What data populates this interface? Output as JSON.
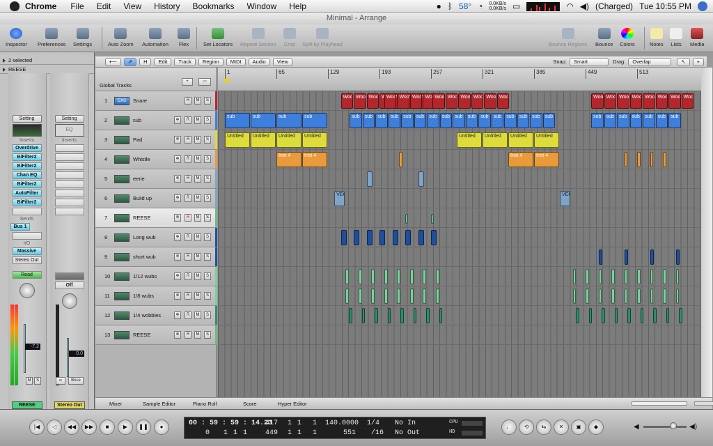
{
  "menubar": {
    "app": "Chrome",
    "items": [
      "File",
      "Edit",
      "View",
      "History",
      "Bookmarks",
      "Window",
      "Help"
    ],
    "temp": "58°",
    "net_up": "0.0KB/s",
    "net_down": "0.0KB/s",
    "battery": "(Charged)",
    "clock": "Tue 10:55 PM"
  },
  "window": {
    "title": "Minimal - Arrange"
  },
  "toolbar": {
    "inspector": "Inspector",
    "preferences": "Preferences",
    "settings": "Settings",
    "auto_zoom": "Auto Zoom",
    "automation": "Automation",
    "flex": "Flex",
    "set_locators": "Set Locators",
    "repeat_section": "Repeat Section",
    "crop": "Crop",
    "split": "Split by Playhead",
    "bounce_regions": "Bounce Regions",
    "bounce": "Bounce",
    "colors": "Colors",
    "notes": "Notes",
    "lists": "Lists",
    "media": "Media"
  },
  "inspector": {
    "selected": "2 selected",
    "region": "REESE",
    "strip1": {
      "setting": "Setting",
      "inserts_label": "Inserts",
      "inserts": [
        "Overdrive",
        "BiFilter2",
        "BiFilter2",
        "Chan EQ",
        "BiFilter2",
        "AutoFilter",
        "BiFilter2"
      ],
      "sends_label": "Sends",
      "send": "Bus 1",
      "io_label": "I/O",
      "input": "Massive",
      "output": "Stereo Out",
      "mode": "Read",
      "volume": "-7.2",
      "m": "M",
      "s": "S",
      "name": "REESE"
    },
    "strip2": {
      "setting": "Setting",
      "eq": "EQ",
      "inserts_label": "Inserts",
      "mode": "Off",
      "volume": "0.0",
      "bnce": "Bnce",
      "m": "M",
      "s": "S",
      "name": "Stereo Out"
    }
  },
  "arrange": {
    "edit": "Edit",
    "track": "Track",
    "region": "Region",
    "midi": "MIDI",
    "audio": "Audio",
    "view": "View",
    "snap_label": "Snap:",
    "snap": "Smart",
    "drag_label": "Drag:",
    "drag": "Overlap",
    "global_tracks": "Global Tracks",
    "h": "H"
  },
  "ruler": [
    "1",
    "65",
    "129",
    "193",
    "257",
    "321",
    "385",
    "449",
    "513"
  ],
  "tracks": [
    {
      "n": "1",
      "name": "Snare",
      "icon": "EXS"
    },
    {
      "n": "2",
      "name": "sub"
    },
    {
      "n": "3",
      "name": "Pad"
    },
    {
      "n": "4",
      "name": "Whistle"
    },
    {
      "n": "5",
      "name": "eerie"
    },
    {
      "n": "6",
      "name": "Build up"
    },
    {
      "n": "7",
      "name": "REESE"
    },
    {
      "n": "8",
      "name": "Long wub"
    },
    {
      "n": "9",
      "name": "short wub"
    },
    {
      "n": "10",
      "name": "1/12 wubs"
    },
    {
      "n": "11",
      "name": "1/8 wubs"
    },
    {
      "n": "12",
      "name": "1/4 wobbles"
    },
    {
      "n": "13",
      "name": "REESE"
    }
  ],
  "region_labels": {
    "snare": "Woo",
    "sub": "sub",
    "pad": "Untitled",
    "whistle": "Inst 4",
    "build": "VEC"
  },
  "colors": {
    "snare": "#b3262b",
    "sub": "#3f7fdc",
    "pad": "#dedc3a",
    "whistle": "#e99a3a",
    "eerie": "#7fa4c6",
    "build": "#7fa4c6",
    "long": "#1d4f9e",
    "short": "#1d4f9e",
    "wubs12": "#7bcf9b",
    "wubs8": "#7bcf9b",
    "wob": "#2c8f6c",
    "reese": "#6cb88a"
  },
  "bottom_tabs": [
    "Mixer",
    "Sample Editor",
    "Piano Roll",
    "Score",
    "Hyper Editor"
  ],
  "transport": {
    "smpte": "00 : 59 : 59 : 14.23",
    "bars_top": [
      "417",
      "1",
      "1",
      "1"
    ],
    "bars_bottom": [
      "0",
      "1",
      "1",
      "1"
    ],
    "bars2": [
      "449",
      "1",
      "1",
      "1"
    ],
    "tempo": "140.0000",
    "tempo_low": "551",
    "sig": "1/4",
    "div": "/16",
    "in": "No In",
    "out": "No Out",
    "cpu": "CPU",
    "hd": "HD"
  }
}
